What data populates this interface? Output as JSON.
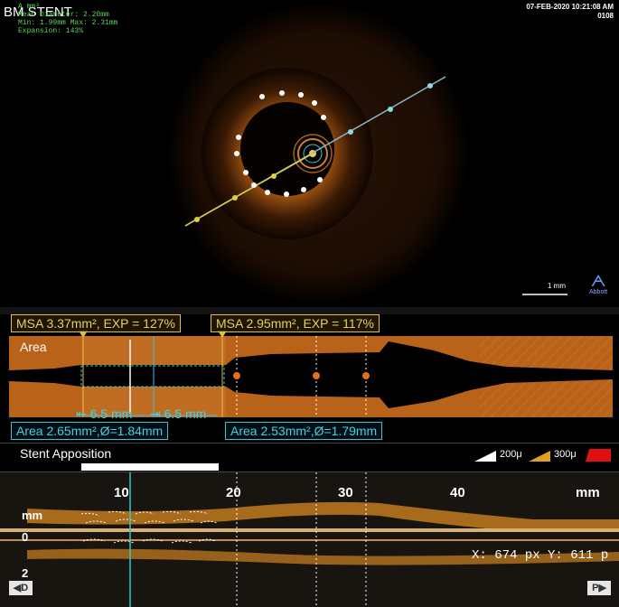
{
  "header": {
    "title": "BM  STENT",
    "stats": [
      "A      mm²",
      "Mean Diameter: 2.20mm",
      "Min: 1.99mm  Max: 2.31mm",
      "Expansion: 143%"
    ],
    "date": "07-FEB-2020 10:21:08 AM",
    "id": "0108"
  },
  "scale_bar": {
    "label": "1 mm"
  },
  "logo": {
    "text": "Abbott"
  },
  "area_panel": {
    "label": "Area",
    "msa_left": "MSA 3.37mm², EXP = 127%",
    "msa_right": "MSA 2.95mm², EXP = 117%",
    "dist_left": "6.5 mm",
    "dist_right": "6.5 mm",
    "area_left": "Area 2.65mm²,Ø=1.84mm",
    "area_right": "Area 2.53mm²,Ø=1.79mm"
  },
  "apposition": {
    "label": "Stent Apposition",
    "legend": [
      {
        "label": "200μ",
        "color": "#ffffff"
      },
      {
        "label": "300μ",
        "color": "#e0a020"
      },
      {
        "label": "",
        "color": "#e01010"
      }
    ]
  },
  "longitudinal": {
    "ticks": [
      "10",
      "20",
      "30",
      "40"
    ],
    "unit_right": "mm",
    "y_unit": "mm",
    "y_ticks": [
      "0",
      "2"
    ],
    "coord_readout": "X: 674 px Y: 611 p"
  },
  "nav": {
    "left": "D",
    "right": "P"
  },
  "colors": {
    "accent_cyan": "#39c4d4",
    "msa_yellow": "#e0c040",
    "tissue_orange": "#c8721e"
  }
}
